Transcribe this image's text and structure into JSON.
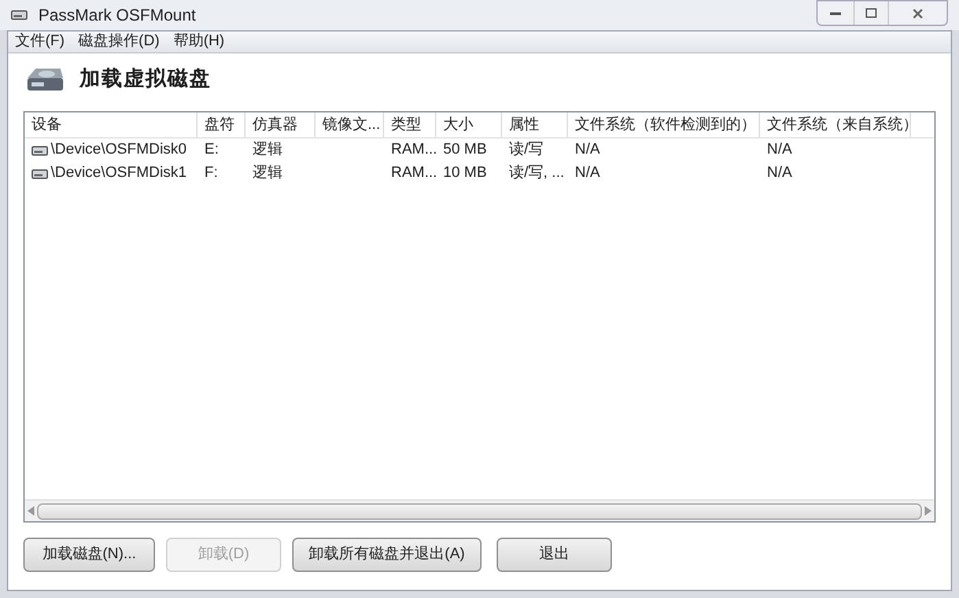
{
  "window": {
    "title": "PassMark OSFMount"
  },
  "menu": [
    {
      "label": "文件(F)"
    },
    {
      "label": "磁盘操作(D)"
    },
    {
      "label": "帮助(H)"
    }
  ],
  "heading": "加载虚拟磁盘",
  "table": {
    "columns": [
      "设备",
      "盘符",
      "仿真器",
      "镜像文...",
      "类型",
      "大小",
      "属性",
      "文件系统（软件检测到的）",
      "文件系统（来自系统）"
    ],
    "rows": [
      {
        "cells": [
          "\\Device\\OSFMDisk0",
          "E:",
          "逻辑",
          "",
          "RAM...",
          "50 MB",
          "读/写",
          "N/A",
          "N/A"
        ],
        "selected": false
      },
      {
        "cells": [
          "\\Device\\OSFMDisk1",
          "F:",
          "逻辑",
          "",
          "RAM...",
          "10 MB",
          "读/写, ...",
          "N/A",
          "N/A"
        ],
        "selected": false
      }
    ]
  },
  "buttons": [
    {
      "label": "加载磁盘(N)...",
      "disabled": false
    },
    {
      "label": "卸载(D)",
      "disabled": true
    },
    {
      "label": "卸载所有磁盘并退出(A)",
      "disabled": false
    },
    {
      "label": "退出",
      "disabled": false
    }
  ]
}
